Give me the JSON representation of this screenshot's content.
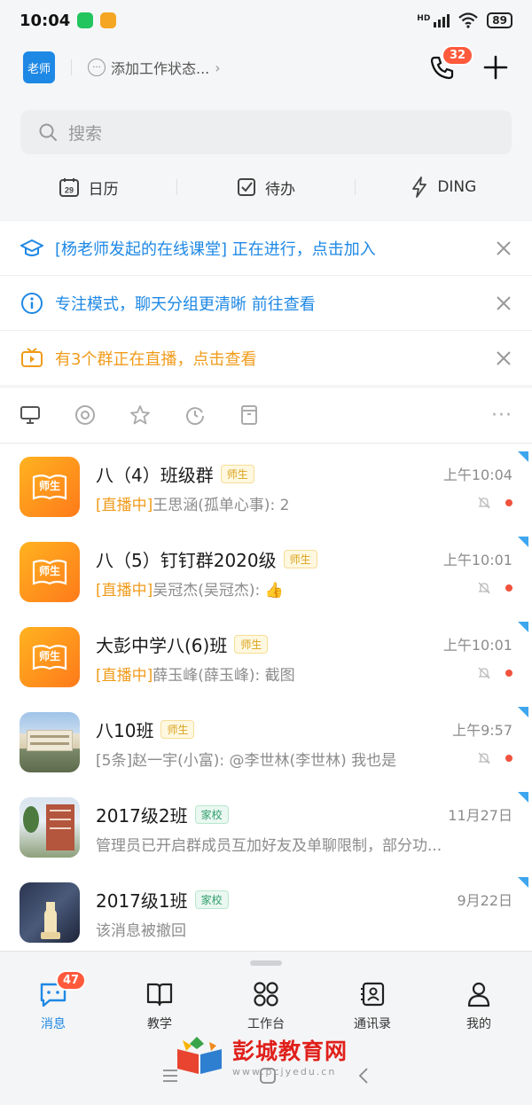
{
  "status_bar": {
    "time": "10:04",
    "hd": "HD",
    "battery": "89"
  },
  "header": {
    "avatar_label": "老师",
    "work_status": "添加工作状态...",
    "call_badge": "32"
  },
  "search": {
    "placeholder": "搜索"
  },
  "quick_tabs": [
    {
      "label": "日历",
      "icon": "calendar-icon",
      "day": "29"
    },
    {
      "label": "待办",
      "icon": "checkbox-icon"
    },
    {
      "label": "DING",
      "icon": "lightning-icon"
    }
  ],
  "notices": [
    {
      "text": "[杨老师发起的在线课堂] 正在进行，点击加入",
      "icon": "graduation-cap-icon",
      "color": "#1e88e5"
    },
    {
      "text": "专注模式，聊天分组更清晰 前往查看",
      "icon": "info-icon",
      "color": "#1e88e5"
    },
    {
      "text": "有3个群正在直播，点击查看",
      "icon": "tv-icon",
      "color": "#f09b1a"
    }
  ],
  "chats": [
    {
      "name": "八（4）班级群",
      "tag": "师生",
      "tag_type": "teacher",
      "time": "上午10:04",
      "live": "[直播中]",
      "preview": "王思涵(孤单心事): 2",
      "muted": true,
      "unread": true,
      "avatar": "book-icon",
      "avatar_label": "师生"
    },
    {
      "name": "八（5）钉钉群2020级",
      "tag": "师生",
      "tag_type": "teacher",
      "time": "上午10:01",
      "live": "[直播中]",
      "preview": "吴冠杰(吴冠杰): 👍",
      "muted": true,
      "unread": true,
      "avatar": "book-icon",
      "avatar_label": "师生"
    },
    {
      "name": "大彭中学八(6)班",
      "tag": "师生",
      "tag_type": "teacher",
      "time": "上午10:01",
      "live": "[直播中]",
      "preview": "薛玉峰(薛玉峰): 截图",
      "muted": true,
      "unread": false,
      "avatar": "book-icon",
      "avatar_label": "师生"
    },
    {
      "name": "八10班",
      "tag": "师生",
      "tag_type": "teacher",
      "time": "上午9:57",
      "live": "",
      "preview": "[5条]赵一宇(小富): @李世林(李世林) 我也是",
      "muted": true,
      "unread": true,
      "avatar": "school-photo-1"
    },
    {
      "name": "2017级2班",
      "tag": "家校",
      "tag_type": "home",
      "time": "11月27日",
      "live": "",
      "preview": "管理员已开启群成员互加好友及单聊限制，部分功...",
      "muted": false,
      "unread": false,
      "avatar": "school-photo-2"
    },
    {
      "name": "2017级1班",
      "tag": "家校",
      "tag_type": "home",
      "time": "9月22日",
      "live": "",
      "preview": "该消息被撤回",
      "muted": false,
      "unread": false,
      "avatar": "chess-photo"
    }
  ],
  "bottom_nav": [
    {
      "label": "消息",
      "icon": "chat-icon",
      "badge": "47",
      "active": true
    },
    {
      "label": "教学",
      "icon": "book-open-icon"
    },
    {
      "label": "工作台",
      "icon": "grid-icon"
    },
    {
      "label": "通讯录",
      "icon": "contacts-icon"
    },
    {
      "label": "我的",
      "icon": "person-icon"
    }
  ],
  "watermark": {
    "title": "彭城教育网",
    "url": "www.pcjyedu.cn"
  },
  "colors": {
    "accent": "#1e88e5",
    "live": "#f09b1a",
    "badge": "#ff5a3c"
  }
}
